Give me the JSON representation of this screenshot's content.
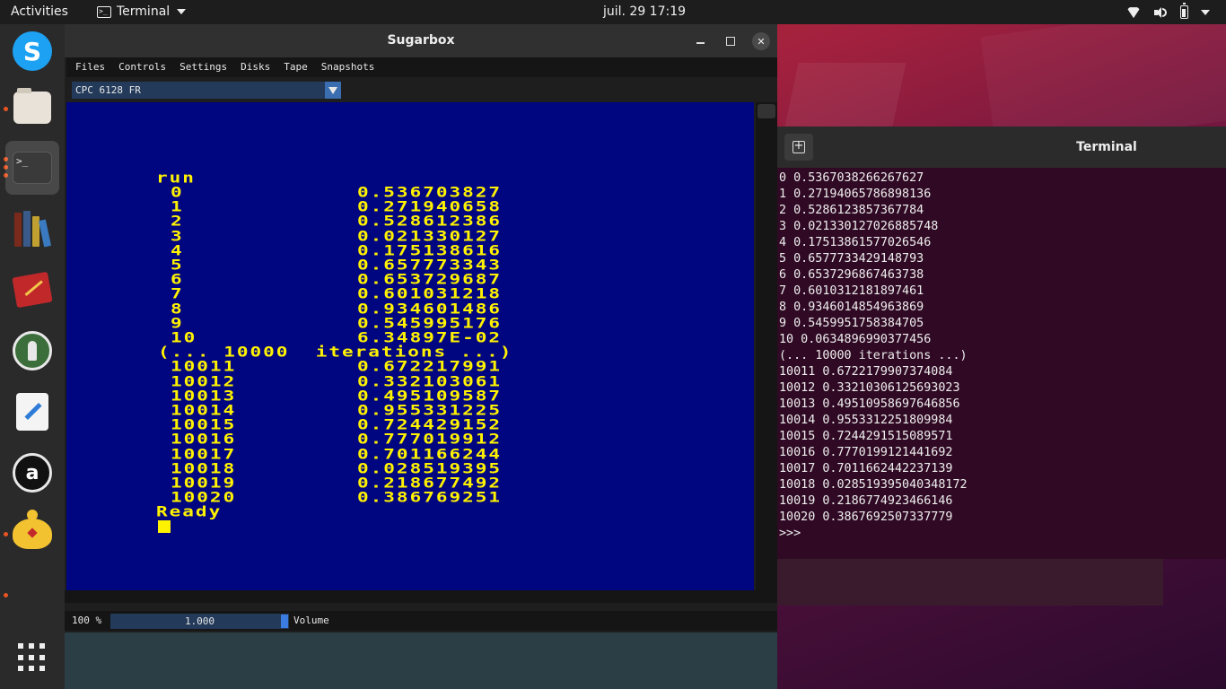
{
  "topbar": {
    "activities": "Activities",
    "app_name": "Terminal",
    "clock": "juil. 29  17:19"
  },
  "dock": {
    "items": [
      "skype",
      "files",
      "terminal",
      "calibre",
      "notebook",
      "keepassxc",
      "text-editor",
      "amazon",
      "genie",
      "show-apps"
    ]
  },
  "sugarbox": {
    "title": "Sugarbox",
    "menu": [
      "Files",
      "Controls",
      "Settings",
      "Disks",
      "Tape",
      "Snapshots"
    ],
    "model": "CPC 6128 FR",
    "screen": {
      "command": "run",
      "rows_a": [
        {
          "i": "0",
          "v": "0.536703827"
        },
        {
          "i": "1",
          "v": "0.271940658"
        },
        {
          "i": "2",
          "v": "0.528612386"
        },
        {
          "i": "3",
          "v": "0.021330127"
        },
        {
          "i": "4",
          "v": "0.175138616"
        },
        {
          "i": "5",
          "v": "0.657773343"
        },
        {
          "i": "6",
          "v": "0.653729687"
        },
        {
          "i": "7",
          "v": "0.601031218"
        },
        {
          "i": "8",
          "v": "0.934601486"
        },
        {
          "i": "9",
          "v": "0.545995176"
        },
        {
          "i": "10",
          "v": "6.34897E-02"
        }
      ],
      "separator": "(... 10000  iterations ...)",
      "rows_b": [
        {
          "i": "10011",
          "v": "0.672217991"
        },
        {
          "i": "10012",
          "v": "0.332103061"
        },
        {
          "i": "10013",
          "v": "0.495109587"
        },
        {
          "i": "10014",
          "v": "0.955331225"
        },
        {
          "i": "10015",
          "v": "0.724429152"
        },
        {
          "i": "10016",
          "v": "0.777019912"
        },
        {
          "i": "10017",
          "v": "0.701166244"
        },
        {
          "i": "10018",
          "v": "0.028519395"
        },
        {
          "i": "10019",
          "v": "0.218677492"
        },
        {
          "i": "10020",
          "v": "0.386769251"
        }
      ],
      "ready": "Ready"
    },
    "zoom": "100 %",
    "speed": "1.000",
    "volume_label": "Volume"
  },
  "terminal": {
    "title": "Terminal",
    "lines": [
      "0 0.5367038266267627",
      "1 0.27194065786898136",
      "2 0.5286123857367784",
      "3 0.021330127026885748",
      "4 0.17513861577026546",
      "5 0.6577733429148793",
      "6 0.6537296867463738",
      "7 0.6010312181897461",
      "8 0.9346014854963869",
      "9 0.5459951758384705",
      "10 0.0634896990377456",
      "(... 10000 iterations ...)",
      "10011 0.6722179907374084",
      "10012 0.33210306125693023",
      "10013 0.49510958697646856",
      "10014 0.9553312251809984",
      "10015 0.7244291515089571",
      "10016 0.7770199121441692",
      "10017 0.7011662442237139",
      "10018 0.028519395040348172",
      "10019 0.2186774923466146",
      "10020 0.3867692507337779",
      ">>>"
    ]
  }
}
